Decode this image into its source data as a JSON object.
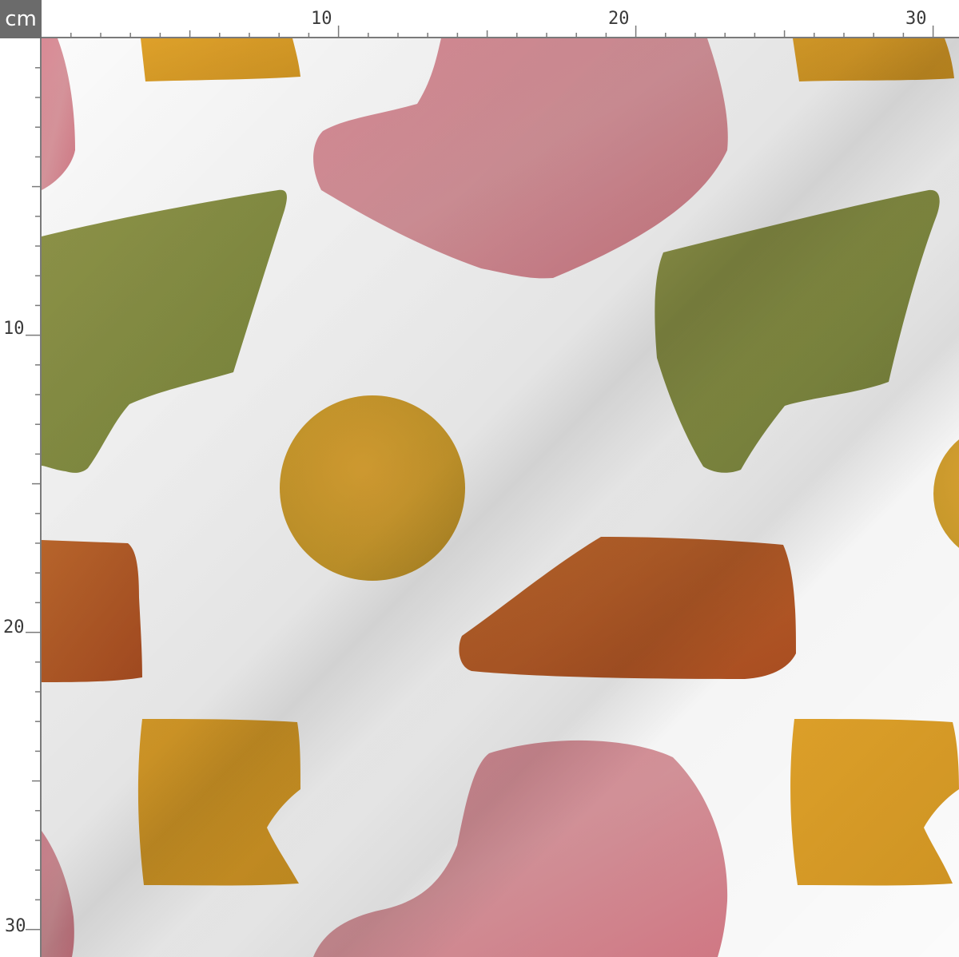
{
  "ruler": {
    "unit": "cm",
    "top_labels": [
      "10",
      "20",
      "30"
    ],
    "left_labels": [
      "10",
      "20",
      "30"
    ]
  },
  "colors": {
    "pink": "#d98a95",
    "olive": "#8c9148",
    "mustard": "#d9a12a",
    "rust": "#b8592a",
    "ruler_line": "#7a7a7a",
    "corner_bg": "#6b6b6b"
  },
  "pattern": {
    "description_shapes": [
      "pink-blob",
      "olive-polygon",
      "mustard-circle",
      "rust-trapezoid",
      "mustard-flag"
    ]
  }
}
